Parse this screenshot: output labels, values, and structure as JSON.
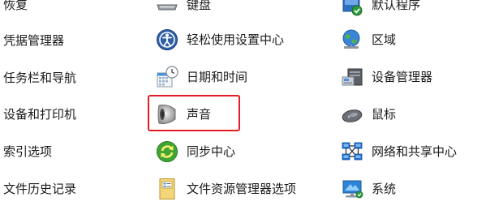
{
  "control_panel": {
    "col1": [
      "恢复",
      "凭据管理器",
      "任务栏和导航",
      "设备和打印机",
      "索引选项",
      "文件历史记录"
    ],
    "col2": [
      "键盘",
      "轻松使用设置中心",
      "日期和时间",
      "声音",
      "同步中心",
      "文件资源管理器选项"
    ],
    "col3": [
      "默认程序",
      "区域",
      "设备管理器",
      "鼠标",
      "网络和共享中心",
      "系统"
    ]
  },
  "icons": {
    "col2": [
      "keyboard-icon",
      "ease-of-access-icon",
      "date-time-icon",
      "sound-icon",
      "sync-center-icon",
      "file-explorer-options-icon"
    ],
    "col3": [
      "default-programs-icon",
      "region-icon",
      "device-manager-icon",
      "mouse-icon",
      "network-sharing-icon",
      "system-icon"
    ]
  },
  "highlight": {
    "target": "声音",
    "color": "#e51c23"
  }
}
